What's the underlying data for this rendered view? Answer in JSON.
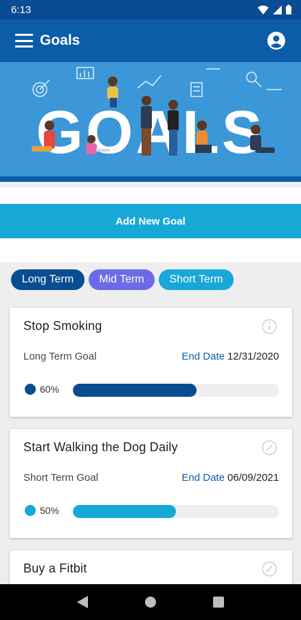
{
  "status_bar": {
    "time": "6:13"
  },
  "app_bar": {
    "title": "Goals",
    "menu_icon": "hamburger-menu-icon",
    "account_icon": "account-circle-icon"
  },
  "hero": {
    "headline": "GOALS"
  },
  "actions": {
    "add_new_goal": "Add New Goal"
  },
  "filters": [
    {
      "label": "Long Term",
      "color": "#0a4c91"
    },
    {
      "label": "Mid Term",
      "color": "#6b6be8"
    },
    {
      "label": "Short Term",
      "color": "#18a8d8"
    }
  ],
  "goals": [
    {
      "title": "Stop Smoking",
      "type": "Long Term Goal",
      "end_date_label": "End Date",
      "end_date": "12/31/2020",
      "percent_label": "60%",
      "progress": 0.6,
      "color": "#0a4c91",
      "icon": "info-icon"
    },
    {
      "title": "Start Walking the Dog Daily",
      "type": "Short Term Goal",
      "end_date_label": "End Date",
      "end_date": "06/09/2021",
      "percent_label": "50%",
      "progress": 0.5,
      "color": "#18a8d8",
      "icon": "edit-icon"
    },
    {
      "title": "Buy a Fitbit",
      "icon": "edit-icon"
    }
  ],
  "colors": {
    "primary_dark": "#0a4c91",
    "primary": "#0d5ca8",
    "accent": "#18a8d8",
    "mid": "#6b6be8"
  }
}
